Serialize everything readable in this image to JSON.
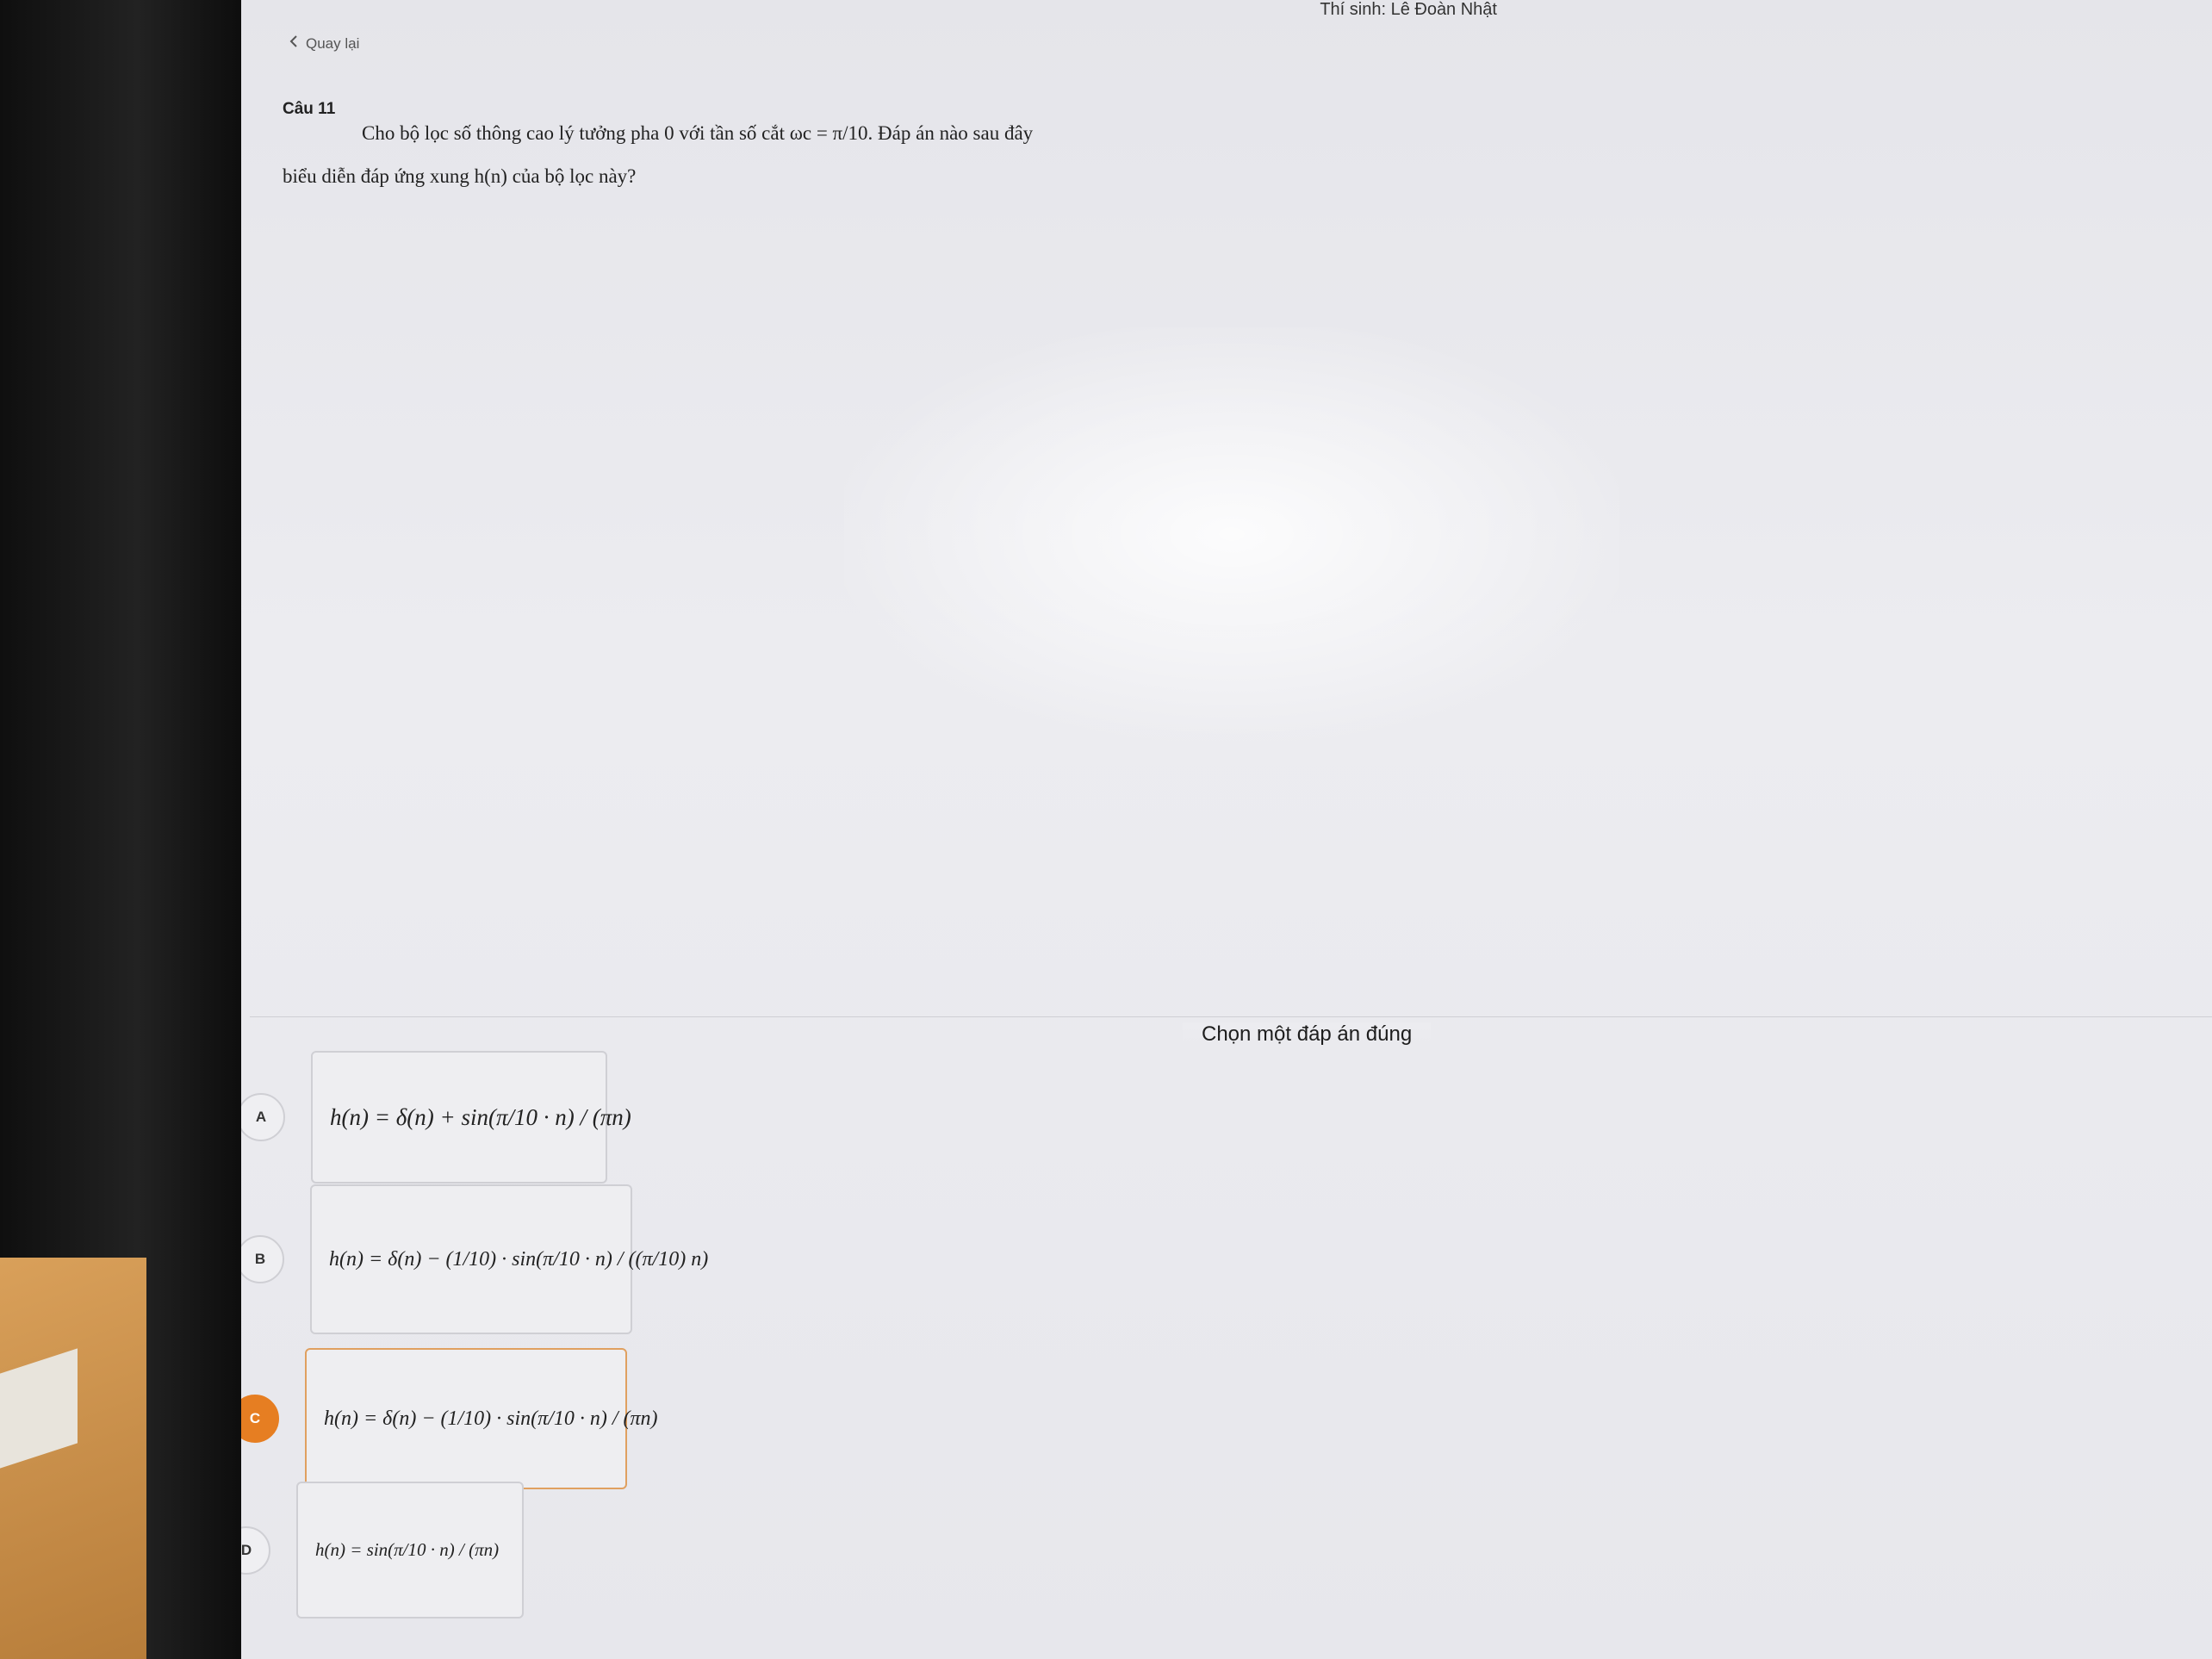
{
  "header": {
    "candidate": "Thí sinh: Lê Đoàn Nhật",
    "back_label": "Quay lại"
  },
  "question": {
    "label": "Câu 11",
    "line1": "Cho bộ lọc số thông cao lý tưởng pha 0 với tần số cắt ωc = π/10. Đáp án nào sau đây",
    "line2": "biểu diễn đáp ứng xung h(n) của bộ lọc này?"
  },
  "instruction": "Chọn một đáp án đúng",
  "options": [
    {
      "letter": "A",
      "formula": "h(n) = δ(n) + sin(π/10 · n) / (πn)",
      "selected": false
    },
    {
      "letter": "B",
      "formula": "h(n) = δ(n) − (1/10) · sin(π/10 · n) / ((π/10) n)",
      "selected": false
    },
    {
      "letter": "C",
      "formula": "h(n) = δ(n) − (1/10) · sin(π/10 · n) / (πn)",
      "selected": true
    },
    {
      "letter": "D",
      "formula": "h(n) = sin(π/10 · n) / (πn)",
      "selected": false
    }
  ],
  "colors": {
    "selected_accent": "#e67e22",
    "page_bg": "#e9e9ed"
  },
  "icons": {
    "back": "chevron-left-icon"
  }
}
